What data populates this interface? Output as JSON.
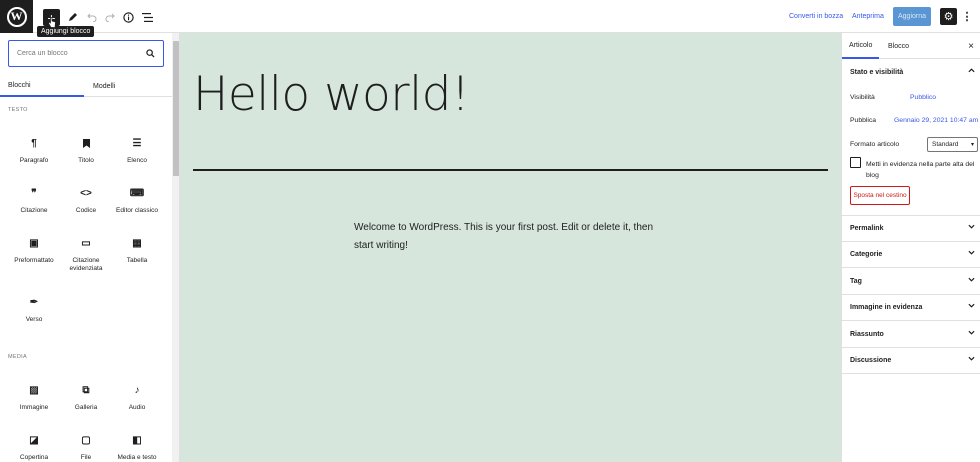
{
  "topbar": {
    "add_block_tooltip": "Aggiungi blocco",
    "save_draft": "Converti in bozza",
    "preview": "Anteprima",
    "update": "Aggiorna"
  },
  "inserter": {
    "search_placeholder": "Cerca un blocco",
    "tabs": [
      {
        "label": "Blocchi"
      },
      {
        "label": "Modelli"
      }
    ],
    "categories": [
      {
        "title": "TESTO",
        "blocks": [
          {
            "label": "Paragrafo",
            "icon": "paragraph-icon",
            "glyph": "¶"
          },
          {
            "label": "Titolo",
            "icon": "bookmark-icon",
            "glyph": "⯁"
          },
          {
            "label": "Elenco",
            "icon": "list-icon",
            "glyph": "☰"
          },
          {
            "label": "Citazione",
            "icon": "quote-icon",
            "glyph": "❞"
          },
          {
            "label": "Codice",
            "icon": "code-icon",
            "glyph": "<>"
          },
          {
            "label": "Editor classico",
            "icon": "keyboard-icon",
            "glyph": "⌨"
          },
          {
            "label": "Preformattato",
            "icon": "preformatted-icon",
            "glyph": "▣"
          },
          {
            "label": "Citazione evidenziata",
            "icon": "pullquote-icon",
            "glyph": "▭"
          },
          {
            "label": "Tabella",
            "icon": "table-icon",
            "glyph": "▦"
          },
          {
            "label": "Verso",
            "icon": "feather-icon",
            "glyph": "✒"
          }
        ]
      },
      {
        "title": "MEDIA",
        "blocks": [
          {
            "label": "Immagine",
            "icon": "image-icon",
            "glyph": "▨"
          },
          {
            "label": "Galleria",
            "icon": "gallery-icon",
            "glyph": "⧉"
          },
          {
            "label": "Audio",
            "icon": "audio-icon",
            "glyph": "♪"
          },
          {
            "label": "Copertina",
            "icon": "cover-icon",
            "glyph": "◪"
          },
          {
            "label": "File",
            "icon": "folder-icon",
            "glyph": "▢"
          },
          {
            "label": "Media e testo",
            "icon": "media-text-icon",
            "glyph": "◧"
          }
        ]
      }
    ]
  },
  "post": {
    "title": "Hello world!",
    "body": "Welcome to WordPress. This is your first post. Edit or delete it, then start writing!"
  },
  "sidebar": {
    "tabs": [
      {
        "label": "Articolo"
      },
      {
        "label": "Blocco"
      }
    ],
    "status_panel": {
      "title": "Stato e visibilità",
      "visibility_label": "Visibilità",
      "visibility_value": "Pubblico",
      "publish_label": "Pubblica",
      "publish_value": "Gennaio 29, 2021 10:47 am",
      "format_label": "Formato articolo",
      "format_value": "Standard",
      "sticky_label": "Metti in evidenza nella parte alta del blog",
      "trash_label": "Sposta nel cestino"
    },
    "panels": [
      {
        "title": "Permalink"
      },
      {
        "title": "Categorie"
      },
      {
        "title": "Tag"
      },
      {
        "title": "Immagine in evidenza"
      },
      {
        "title": "Riassunto"
      },
      {
        "title": "Discussione"
      }
    ]
  },
  "colors": {
    "accent": "#3858e9",
    "canvas": "#d6e6dd",
    "update_button": "#5a96d3",
    "danger": "#cc1818"
  }
}
